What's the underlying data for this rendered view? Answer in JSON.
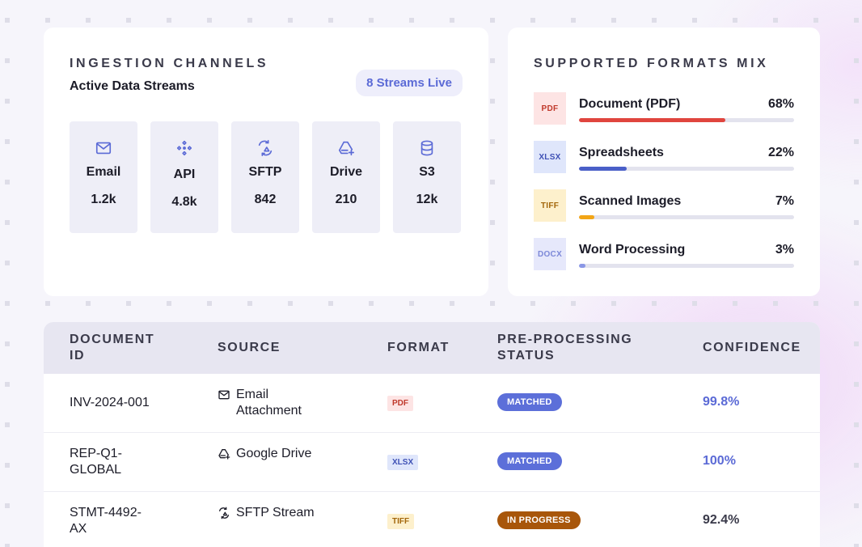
{
  "ingestion": {
    "title": "INGESTION CHANNELS",
    "subtitle": "Active Data Streams",
    "live_pill": "8 Streams Live",
    "channels": [
      {
        "icon": "mail-icon",
        "label": "Email",
        "count": "1.2k"
      },
      {
        "icon": "api-icon",
        "label": "API",
        "count": "4.8k"
      },
      {
        "icon": "sftp-sync-icon",
        "label": "SFTP",
        "count": "842"
      },
      {
        "icon": "drive-icon",
        "label": "Drive",
        "count": "210"
      },
      {
        "icon": "database-icon",
        "label": "S3",
        "count": "12k"
      }
    ]
  },
  "formats": {
    "title": "SUPPORTED FORMATS MIX",
    "items": [
      {
        "badge": "PDF",
        "name": "Document (PDF)",
        "pct": "68%",
        "value": 0.68,
        "color": "#e0453e",
        "badge_bg": "#fde4e4",
        "badge_fg": "#c0392b"
      },
      {
        "badge": "XLSX",
        "name": "Spreadsheets",
        "pct": "22%",
        "value": 0.22,
        "color": "#4a5fc8",
        "badge_bg": "#dfe6fb",
        "badge_fg": "#3f51b5"
      },
      {
        "badge": "TIFF",
        "name": "Scanned Images",
        "pct": "7%",
        "value": 0.07,
        "color": "#f2a516",
        "badge_bg": "#fdf0cc",
        "badge_fg": "#a3660a"
      },
      {
        "badge": "DOCX",
        "name": "Word Processing",
        "pct": "3%",
        "value": 0.03,
        "color": "#8a97e6",
        "badge_bg": "#e6e8fb",
        "badge_fg": "#7c88d8"
      }
    ]
  },
  "table": {
    "headers": {
      "doc_id": "DOCUMENT ID",
      "source": "SOURCE",
      "format": "FORMAT",
      "status": "PRE-PROCESSING STATUS",
      "confidence": "CONFIDENCE"
    },
    "rows": [
      {
        "doc_id": "INV-2024-001",
        "source": "Email Attachment",
        "source_icon": "mail-icon",
        "format": "PDF",
        "status": "MATCHED",
        "confidence": "99.8%"
      },
      {
        "doc_id": "REP-Q1-GLOBAL",
        "source": "Google Drive",
        "source_icon": "drive-icon",
        "format": "XLSX",
        "status": "MATCHED",
        "confidence": "100%"
      },
      {
        "doc_id": "STMT-4492-AX",
        "source": "SFTP Stream",
        "source_icon": "sftp-sync-icon",
        "format": "TIFF",
        "status": "IN PROGRESS",
        "confidence": "92.4%"
      }
    ]
  },
  "colors": {
    "accent": "#5b6ad6",
    "matched": "#5c6fd9",
    "in_progress": "#a8560a",
    "confidence_high": "#5b6ad6",
    "confidence_mid": "#3a3a4a"
  }
}
